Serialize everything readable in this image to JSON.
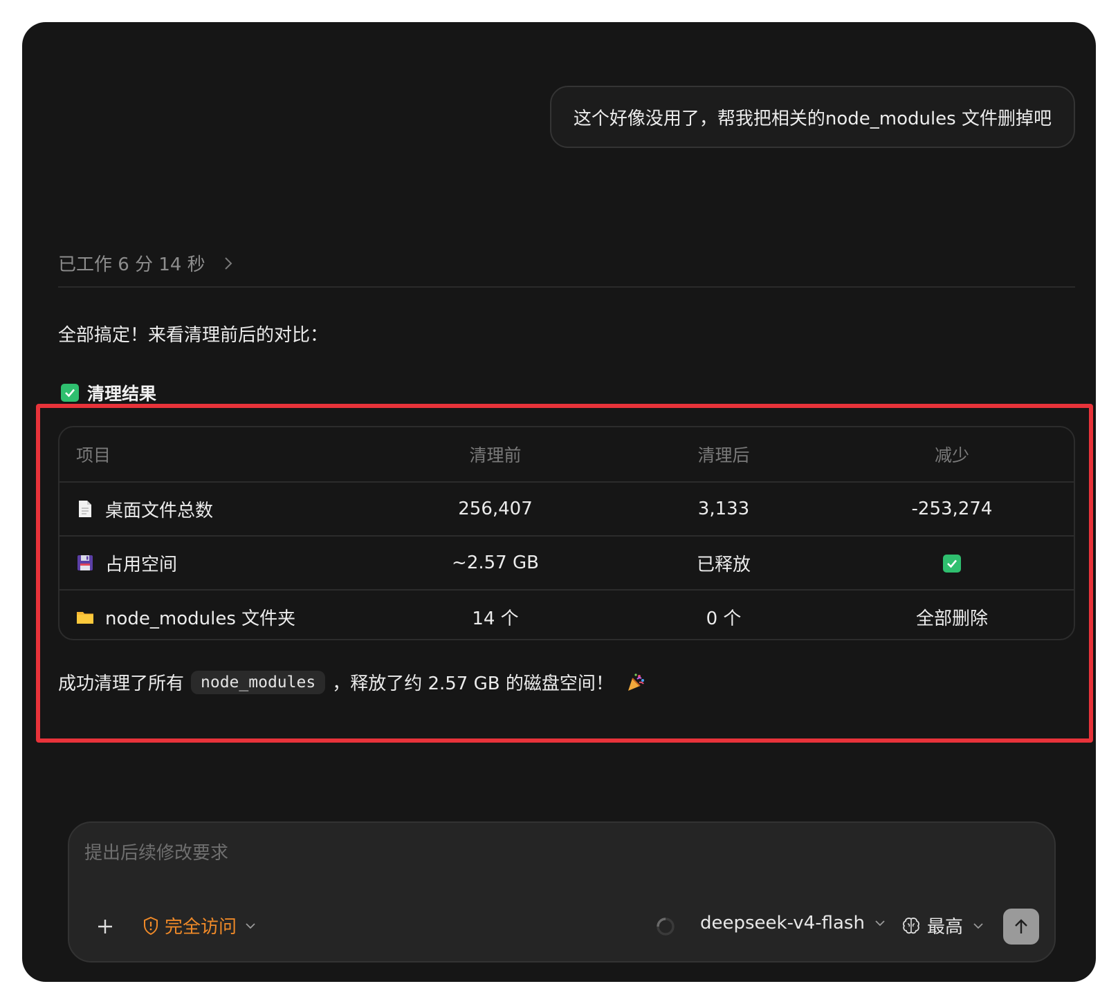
{
  "chat": {
    "user_message": "这个好像没用了，帮我把相关的node_modules 文件删掉吧",
    "worked_label": "已工作 6 分 14 秒",
    "intro": "全部搞定！来看清理前后的对比：",
    "result_heading": "清理结果",
    "summary_prefix": "成功清理了所有",
    "summary_code": "node_modules",
    "summary_suffix": "，释放了约 2.57 GB 的磁盘空间！"
  },
  "table": {
    "headers": [
      "项目",
      "清理前",
      "清理后",
      "减少"
    ],
    "rows": [
      {
        "icon": "document-icon",
        "item": "桌面文件总数",
        "before": "256,407",
        "after": "3,133",
        "reduction": "-253,274"
      },
      {
        "icon": "floppy-disk-icon",
        "item": "占用空间",
        "before": "~2.57 GB",
        "after": "已释放",
        "reduction": ""
      },
      {
        "icon": "folder-icon",
        "item": "node_modules 文件夹",
        "before": "14 个",
        "after": "0 个",
        "reduction": "全部删除"
      }
    ]
  },
  "composer": {
    "placeholder": "提出后续修改要求",
    "access_label": "完全访问",
    "model_label": "deepseek-v4-flash",
    "effort_label": "最高"
  },
  "colors": {
    "accent_orange": "#f08a28",
    "check_green": "#2fbf6f",
    "highlight_red": "#e8333a"
  }
}
